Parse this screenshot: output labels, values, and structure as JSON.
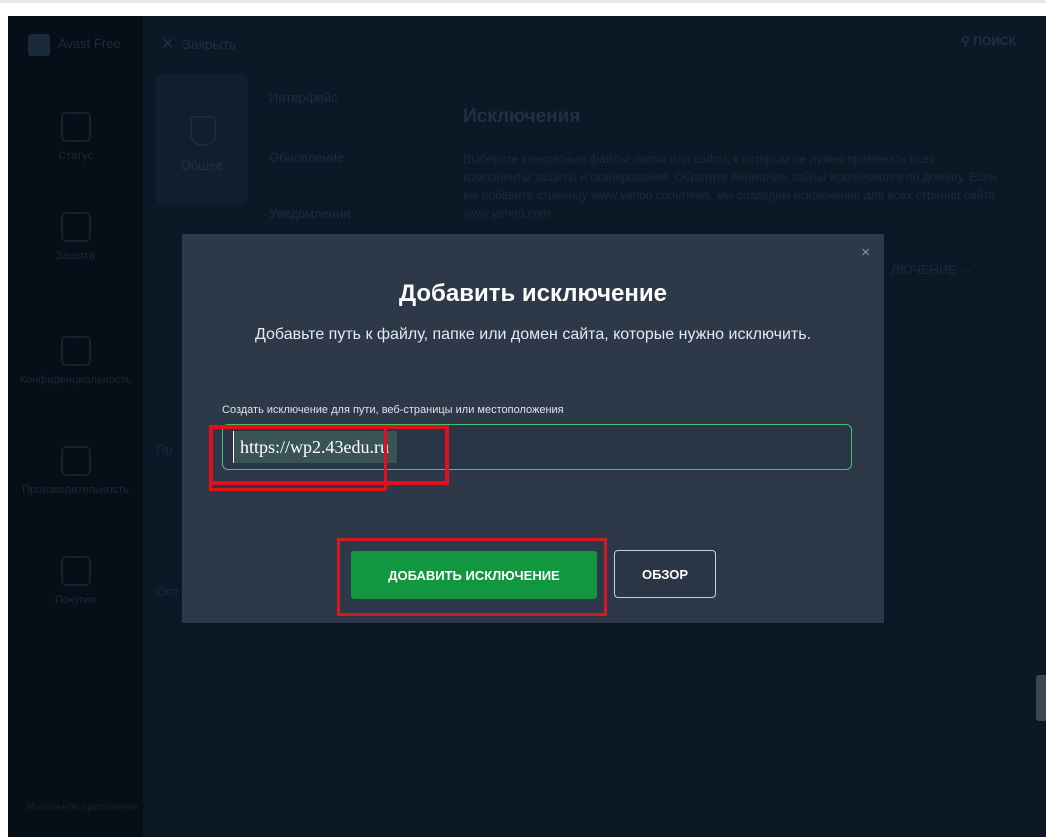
{
  "sidebar": {
    "logo_text": "Avast Free",
    "items": [
      {
        "label": "Статус"
      },
      {
        "label": "Защита"
      },
      {
        "label": "Конфиденциальность"
      },
      {
        "label": "Производительность"
      },
      {
        "label": "Покупки"
      }
    ],
    "bottom_text": "Мобильное приложение"
  },
  "panel": {
    "close_label": "Закрыть",
    "search_label": "ПОИСК",
    "category": "Общее",
    "subnav": [
      "Интерфейс",
      "Обновление",
      "Уведомления"
    ],
    "content_title": "Исключения",
    "content_desc": "Выберите конкретные файлы, папки или сайты, к которым не нужно применять всех компоненты защиты и сканирования. Обратите внимание: сайты исключаются по домену. Если вы добавите страницу www.yahoo.com/news, мы создадим исключение для всех страниц сайта www.yahoo.com.",
    "add_link_fragment": "ЛЮЧЕНИЕ",
    "stub_1": "Пр",
    "stub_2": "Опт"
  },
  "modal": {
    "close_icon": "×",
    "title": "Добавить исключение",
    "subtitle": "Добавьте путь к файлу, папке или домен сайта, которые нужно исключить.",
    "field_label": "Создать исключение для пути, веб-страницы или местоположения",
    "field_value": "https://wp2.43edu.ru",
    "add_button": "ДОБАВИТЬ ИСКЛЮЧЕНИЕ",
    "browse_button": "ОБЗОР"
  },
  "colors": {
    "highlight": "#e3101b",
    "primary_button": "#11973f",
    "field_border": "#43c36a",
    "modal_bg": "#2d3848"
  }
}
